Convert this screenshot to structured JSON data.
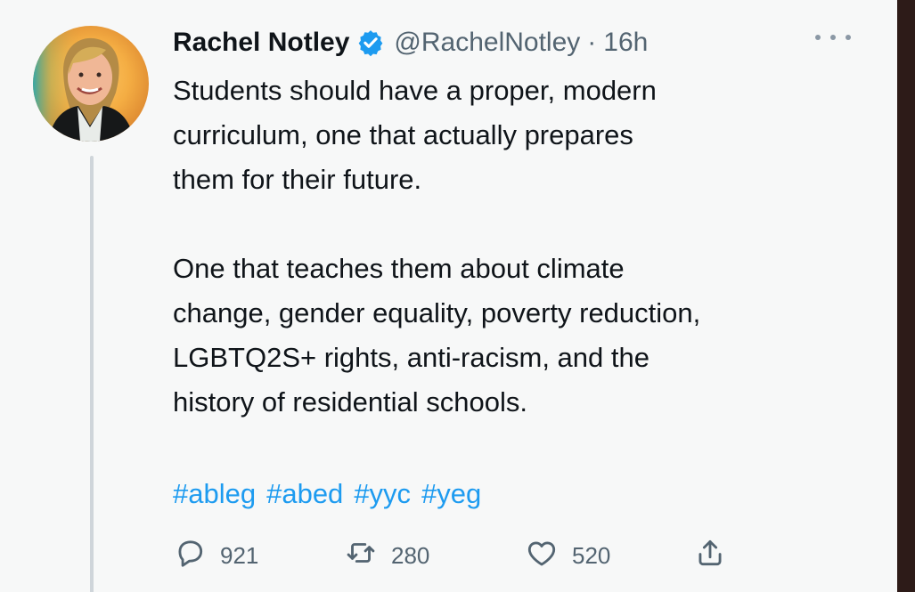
{
  "tweet": {
    "author_name": "Rachel Notley",
    "handle": "@RachelNotley",
    "separator": "·",
    "time": "16h",
    "text_lines": [
      "Students should have a proper, modern",
      "curriculum, one that actually prepares",
      "them for their future.",
      "One that teaches them about climate",
      "change, gender equality, poverty reduction,",
      "LGBTQ2S+ rights, anti-racism, and the",
      "history of residential schools."
    ],
    "hashtags": [
      "#ableg",
      "#abed",
      "#yyc",
      "#yeg"
    ],
    "reply_count": "921",
    "retweet_count": "280",
    "like_count": "520"
  },
  "icons": {
    "verified": "verified-badge-icon",
    "more": "more-icon",
    "reply": "reply-icon",
    "retweet": "retweet-icon",
    "like": "heart-icon",
    "share": "share-icon"
  },
  "colors": {
    "text": "#0f1419",
    "secondary": "#536471",
    "accent": "#1d9bf0",
    "thread_line": "#cfd5da"
  }
}
